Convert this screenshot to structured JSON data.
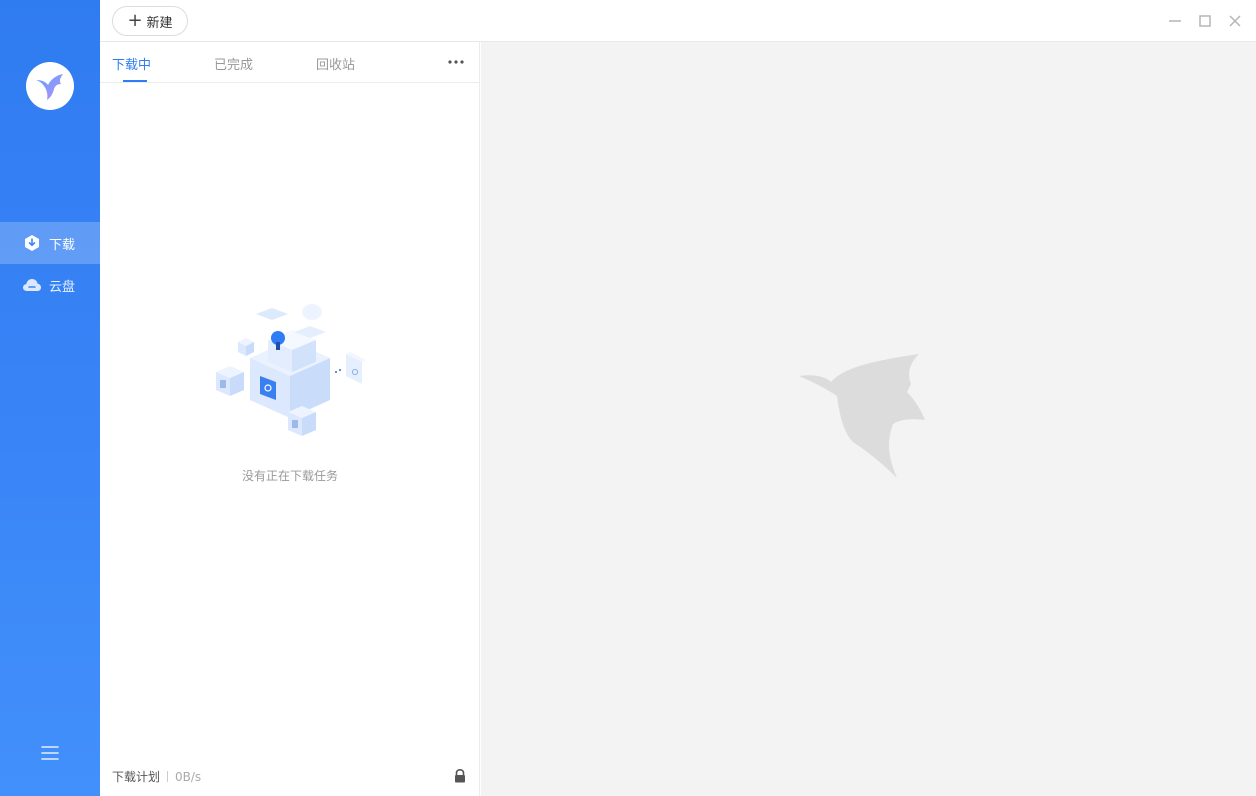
{
  "sidebar": {
    "logo_icon": "hummingbird-logo",
    "items": [
      {
        "label": "下载",
        "icon": "download-icon",
        "active": true
      },
      {
        "label": "云盘",
        "icon": "cloud-icon",
        "active": false
      }
    ],
    "menu_icon": "hamburger-menu-icon"
  },
  "toolbar": {
    "new_label": "新建",
    "window_controls": [
      "minimize-icon",
      "maximize-icon",
      "close-icon"
    ]
  },
  "tabs": [
    {
      "label": "下载中",
      "active": true
    },
    {
      "label": "已完成",
      "active": false
    },
    {
      "label": "回收站",
      "active": false
    }
  ],
  "main": {
    "empty_message": "没有正在下载任务"
  },
  "footer": {
    "plan_label": "下载计划",
    "speed": "0B/s"
  },
  "colors": {
    "accent": "#2e7cf6",
    "sidebar_gradient": [
      "#2f7bf0",
      "#4290fb"
    ],
    "right_bg": "#f3f3f3"
  }
}
